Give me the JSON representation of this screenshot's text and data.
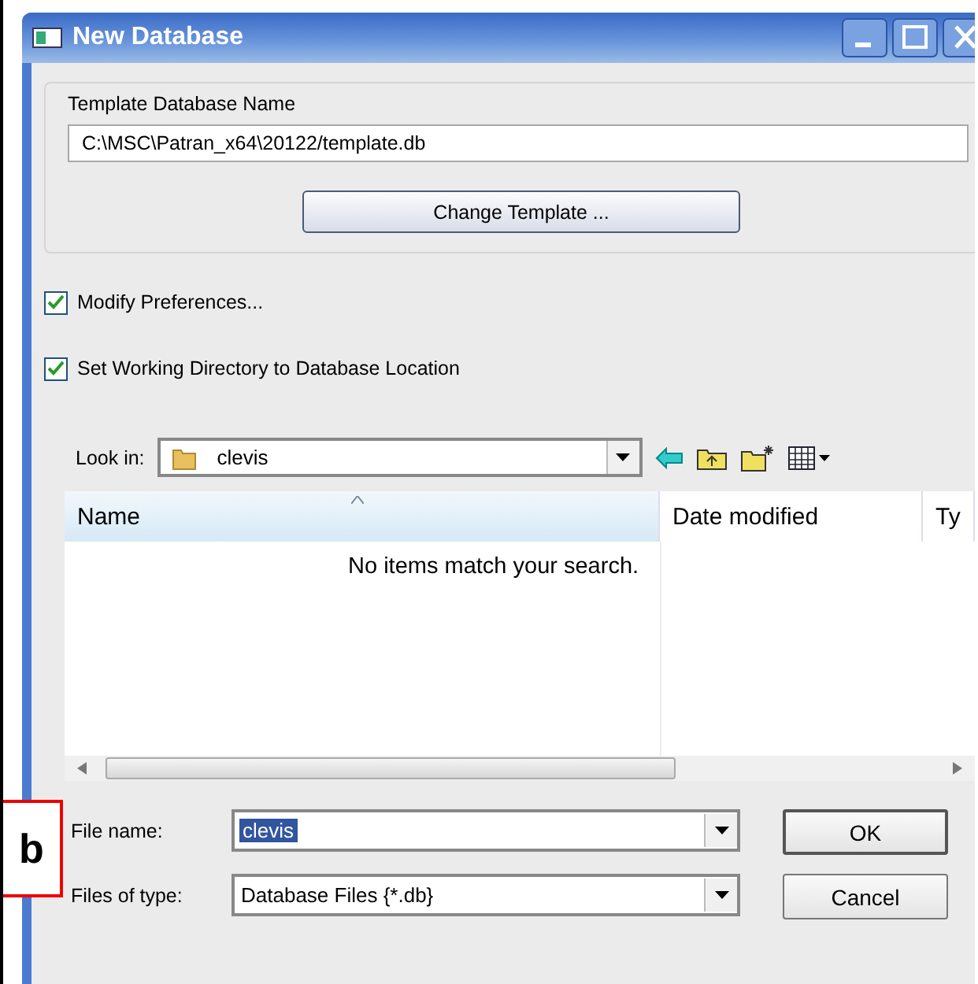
{
  "window": {
    "title": "New Database"
  },
  "template": {
    "label": "Template Database Name",
    "value": "C:\\MSC\\Patran_x64\\20122/template.db",
    "button": "Change Template ..."
  },
  "options": [
    {
      "label": "Modify Preferences...",
      "checked": true
    },
    {
      "label": "Set Working Directory to Database Location",
      "checked": true
    }
  ],
  "look_in": {
    "label": "Look in:",
    "value": "clevis"
  },
  "file_list": {
    "columns": [
      {
        "label": "Name",
        "sorted": true
      },
      {
        "label": "Date modified",
        "sorted": false
      },
      {
        "label": "Ty",
        "sorted": false
      }
    ],
    "empty_message": "No items match your search."
  },
  "file_name": {
    "label": "File name:",
    "value": "clevis",
    "selected": true
  },
  "file_type": {
    "label": "Files of type:",
    "value": "Database Files {*.db}"
  },
  "buttons": [
    "OK",
    "Cancel"
  ],
  "panel_label": "b"
}
